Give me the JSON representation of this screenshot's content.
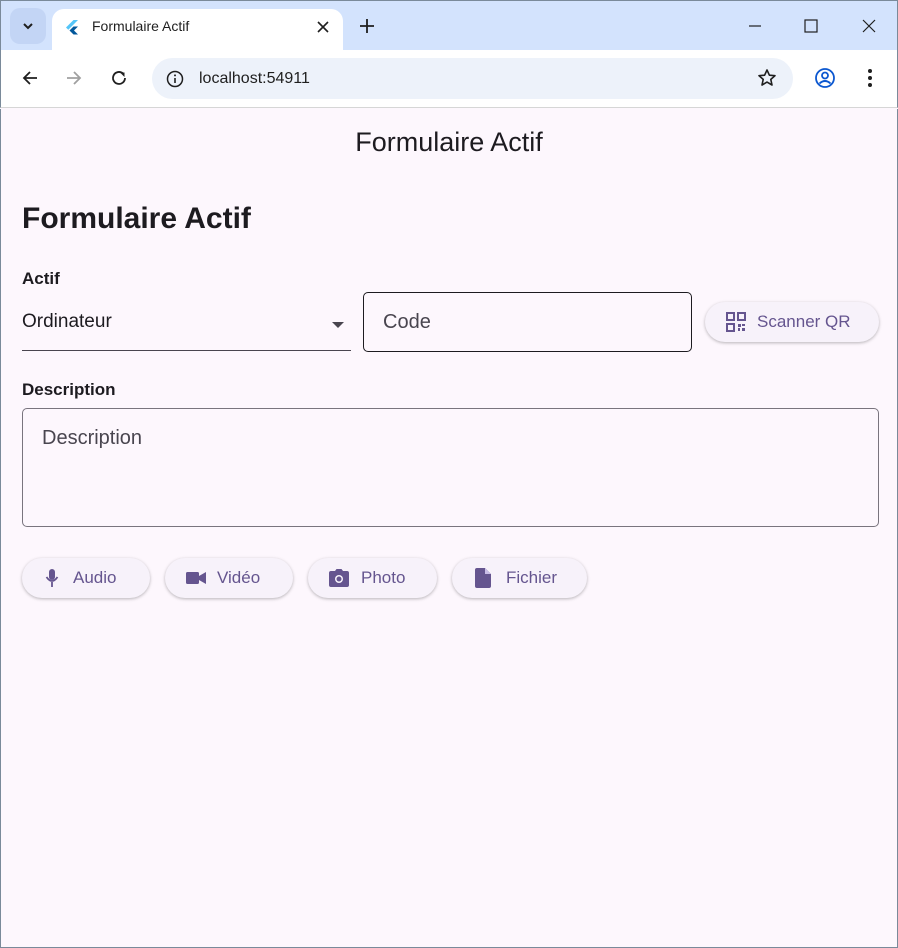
{
  "browser": {
    "tab_title": "Formulaire Actif",
    "url": "localhost:54911",
    "icons": [
      "tab-list-icon",
      "flutter-icon",
      "close-icon",
      "plus-icon",
      "minimize-icon",
      "maximize-icon",
      "close-window-icon",
      "back-arrow-icon",
      "forward-arrow-icon",
      "reload-icon",
      "site-info-icon",
      "star-icon",
      "profile-icon",
      "more-vert-icon"
    ]
  },
  "app": {
    "appbar_title": "Formulaire Actif",
    "heading": "Formulaire Actif",
    "accent_color": "#65558f",
    "background_color": "#fdf7fd"
  },
  "form": {
    "actif_label": "Actif",
    "actif_selected": "Ordinateur",
    "code_placeholder": "Code",
    "scan_button": "Scanner QR",
    "description_label": "Description",
    "description_placeholder": "Description"
  },
  "attachments": {
    "audio": "Audio",
    "video": "Vidéo",
    "photo": "Photo",
    "file": "Fichier"
  }
}
